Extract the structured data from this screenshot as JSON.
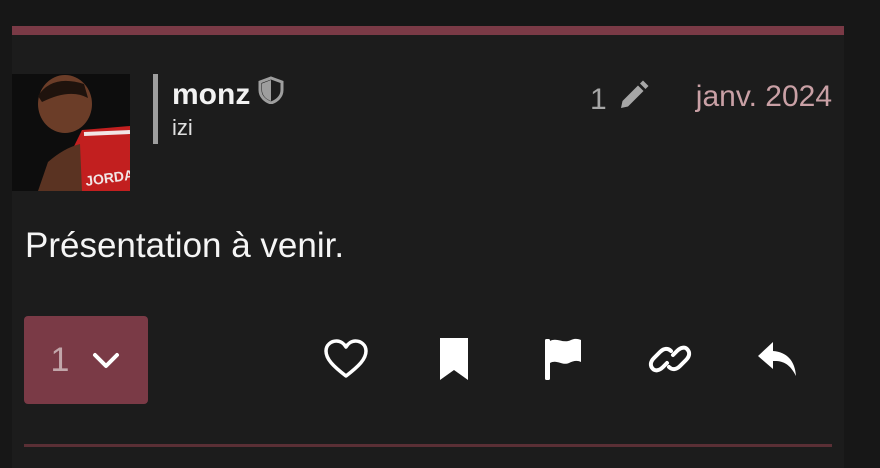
{
  "post": {
    "username": "monz",
    "user_title": "izi",
    "edit_count": "1",
    "date": "janv. 2024",
    "body": "Présentation à venir.",
    "replies_count": "1"
  },
  "icons": {
    "moderator": "shield-icon",
    "edit": "pencil-icon",
    "replies_toggle": "chevron-down-icon",
    "like": "heart-icon",
    "bookmark": "bookmark-icon",
    "flag": "flag-icon",
    "copy_link": "link-icon",
    "reply": "reply-icon"
  },
  "colors": {
    "accent": "#7a3a46",
    "date": "#c9a0a5",
    "background": "#1c1c1c"
  }
}
